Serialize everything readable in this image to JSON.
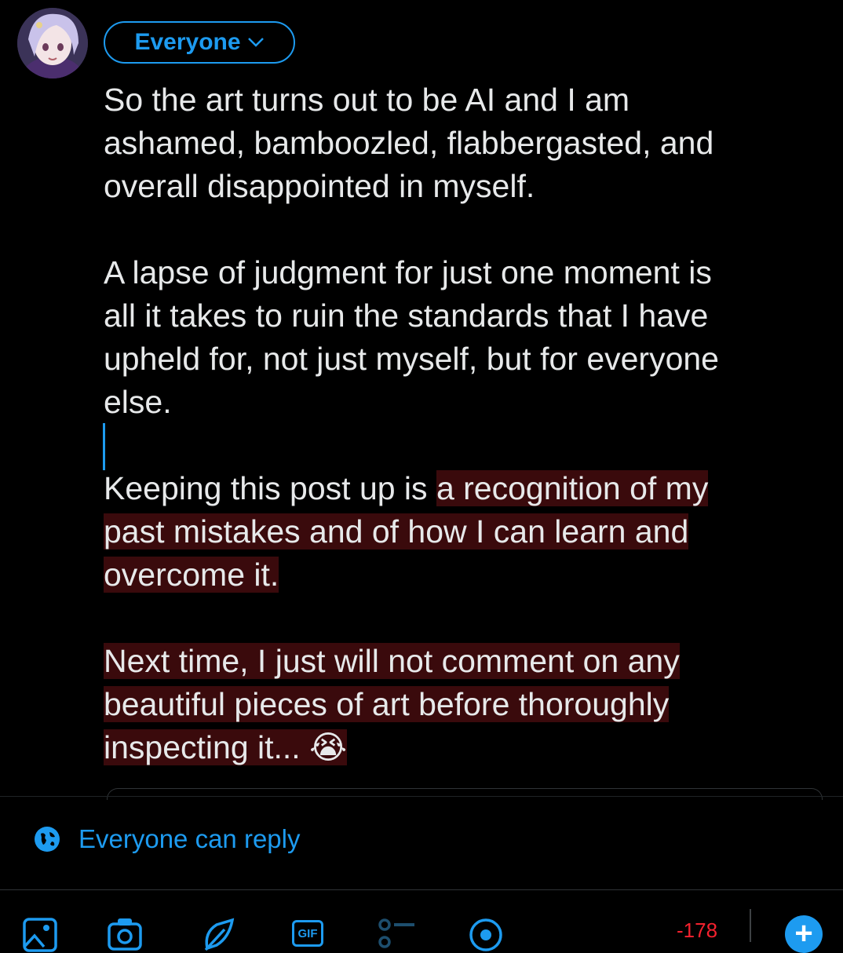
{
  "audience": {
    "label": "Everyone"
  },
  "composer": {
    "paragraphs": [
      "So the art turns out to be AI and I am\nashamed, bamboozled, flabbergasted, and\noverall disappointed in myself.",
      "A lapse of judgment for just one moment is\nall it takes to ruin the standards that I have\nupheld for, not just myself, but for everyone\nelse.",
      "",
      "Keeping this post up is ",
      "a recognition of my\npast mistakes and of how I can learn and\novercome it.\n\nNext time, I just will not comment on any\nbeautiful pieces of art before thoroughly\ninspecting it... 😭"
    ]
  },
  "reply_setting": {
    "label": "Everyone can reply"
  },
  "toolbar": {
    "icons": [
      "image-icon",
      "camera-icon",
      "draw-icon",
      "gif-icon",
      "poll-icon",
      "location-icon"
    ],
    "gif_label": "GIF",
    "char_counter": "-178",
    "add_label": "+"
  },
  "colors": {
    "accent": "#1d9bf0",
    "highlight": "#3a0a0c",
    "error": "#f4212e"
  }
}
